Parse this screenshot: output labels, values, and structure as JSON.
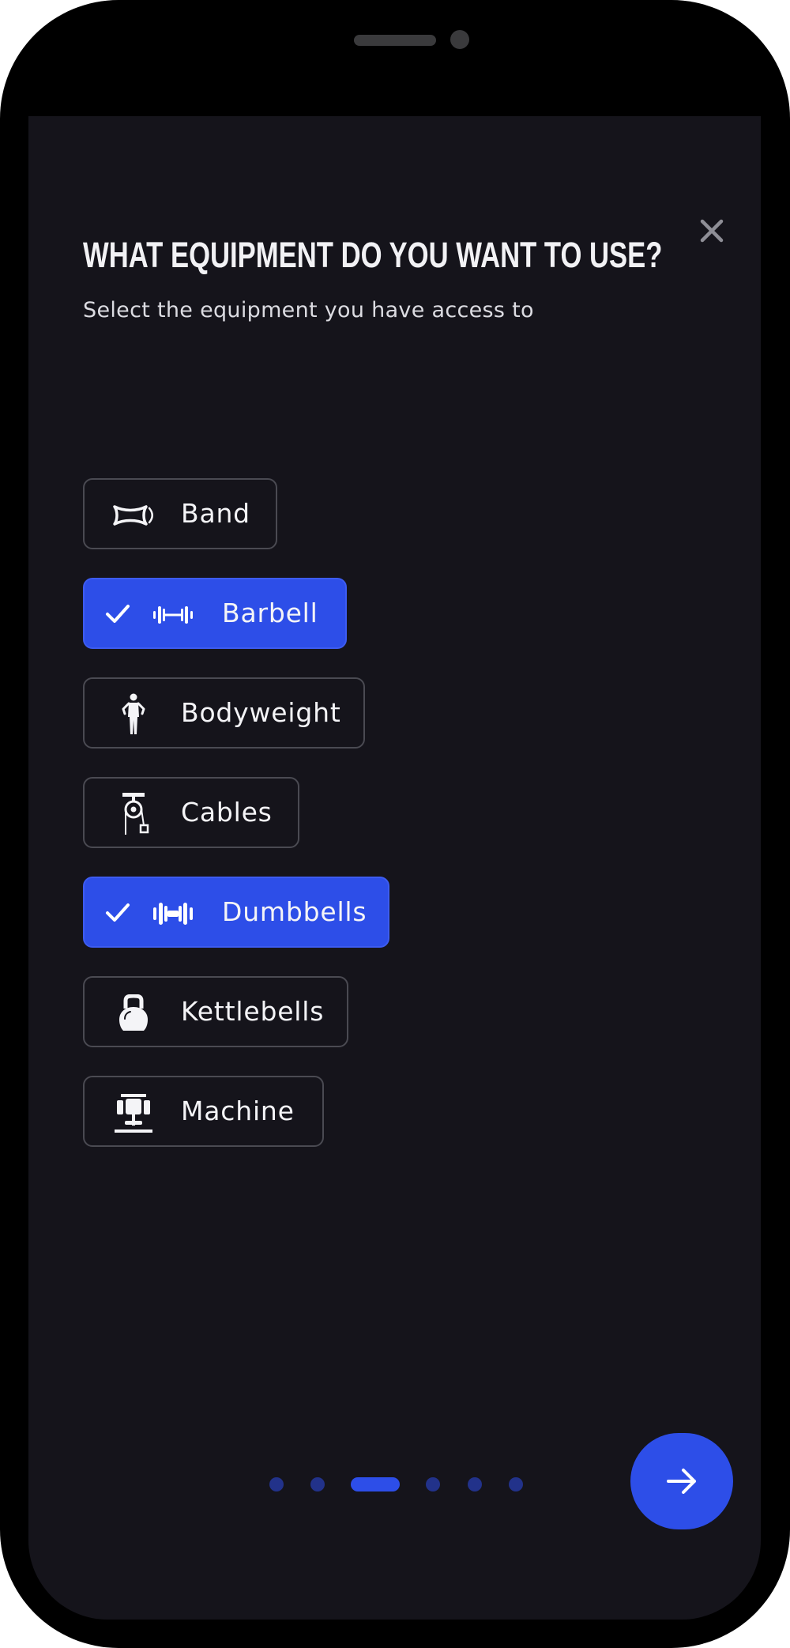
{
  "header": {
    "title": "WHAT EQUIPMENT DO YOU WANT TO USE?",
    "subtitle": "Select the equipment you have access to",
    "close_icon": "close-icon"
  },
  "equipment": [
    {
      "label": "Band",
      "icon": "band-icon",
      "selected": false
    },
    {
      "label": "Barbell",
      "icon": "barbell-icon",
      "selected": true
    },
    {
      "label": "Bodyweight",
      "icon": "bodyweight-icon",
      "selected": false
    },
    {
      "label": "Cables",
      "icon": "cables-icon",
      "selected": false
    },
    {
      "label": "Dumbbells",
      "icon": "dumbbells-icon",
      "selected": true
    },
    {
      "label": "Kettlebells",
      "icon": "kettlebells-icon",
      "selected": false
    },
    {
      "label": "Machine",
      "icon": "machine-icon",
      "selected": false
    }
  ],
  "pagination": {
    "total_steps": 6,
    "current_step": 3
  },
  "next_button": {
    "icon": "arrow-right-icon"
  },
  "colors": {
    "background": "#15141b",
    "accent": "#2d4ee8",
    "dot_inactive": "#22328a",
    "border": "#4a4a52",
    "text": "#f4f4f7"
  }
}
